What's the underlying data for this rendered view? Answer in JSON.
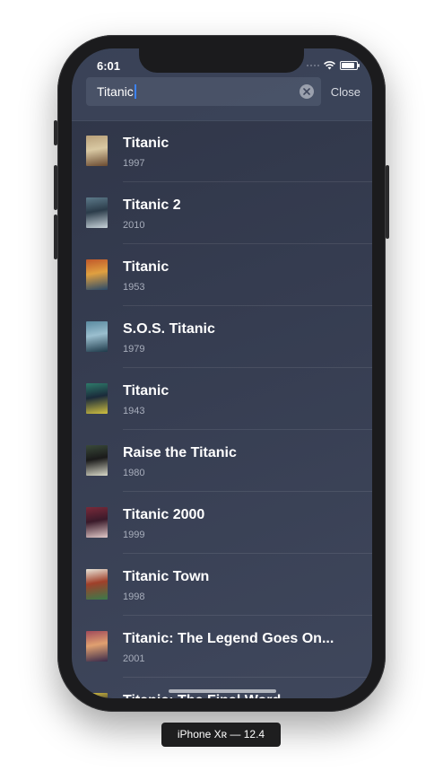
{
  "status_bar": {
    "time": "6:01"
  },
  "search": {
    "query": "Titanic",
    "close_label": "Close"
  },
  "results": [
    {
      "title": "Titanic",
      "year": "1997",
      "poster_colors": [
        "#b8a07a",
        "#6a4a30",
        "#d9c9a3"
      ]
    },
    {
      "title": "Titanic 2",
      "year": "2010",
      "poster_colors": [
        "#5d7a8a",
        "#c8d3da",
        "#2b3c4a"
      ]
    },
    {
      "title": "Titanic",
      "year": "1953",
      "poster_colors": [
        "#c0582a",
        "#2a4a6a",
        "#e0a040"
      ]
    },
    {
      "title": "S.O.S. Titanic",
      "year": "1979",
      "poster_colors": [
        "#5a8aa0",
        "#1e3a4a",
        "#9bbfcf"
      ]
    },
    {
      "title": "Titanic",
      "year": "1943",
      "poster_colors": [
        "#2e7a6a",
        "#d0c040",
        "#1a2a3a"
      ]
    },
    {
      "title": "Raise the Titanic",
      "year": "1980",
      "poster_colors": [
        "#3a4a3a",
        "#d8d8c8",
        "#1a1a1a"
      ]
    },
    {
      "title": "Titanic 2000",
      "year": "1999",
      "poster_colors": [
        "#7a2a3a",
        "#e0c8c8",
        "#3a1a2a"
      ]
    },
    {
      "title": "Titanic Town",
      "year": "1998",
      "poster_colors": [
        "#e8e4d8",
        "#3a7a4a",
        "#a0402a"
      ]
    },
    {
      "title": "Titanic: The Legend Goes On...",
      "year": "2001",
      "poster_colors": [
        "#a04a5a",
        "#3a2a4a",
        "#e0a070"
      ]
    },
    {
      "title": "Titanic: The Final Word",
      "year": "",
      "poster_colors": [
        "#d8c040",
        "#2a3a5a",
        "#1a1a2a"
      ]
    }
  ],
  "device_label": "iPhone Xʀ — 12.4"
}
